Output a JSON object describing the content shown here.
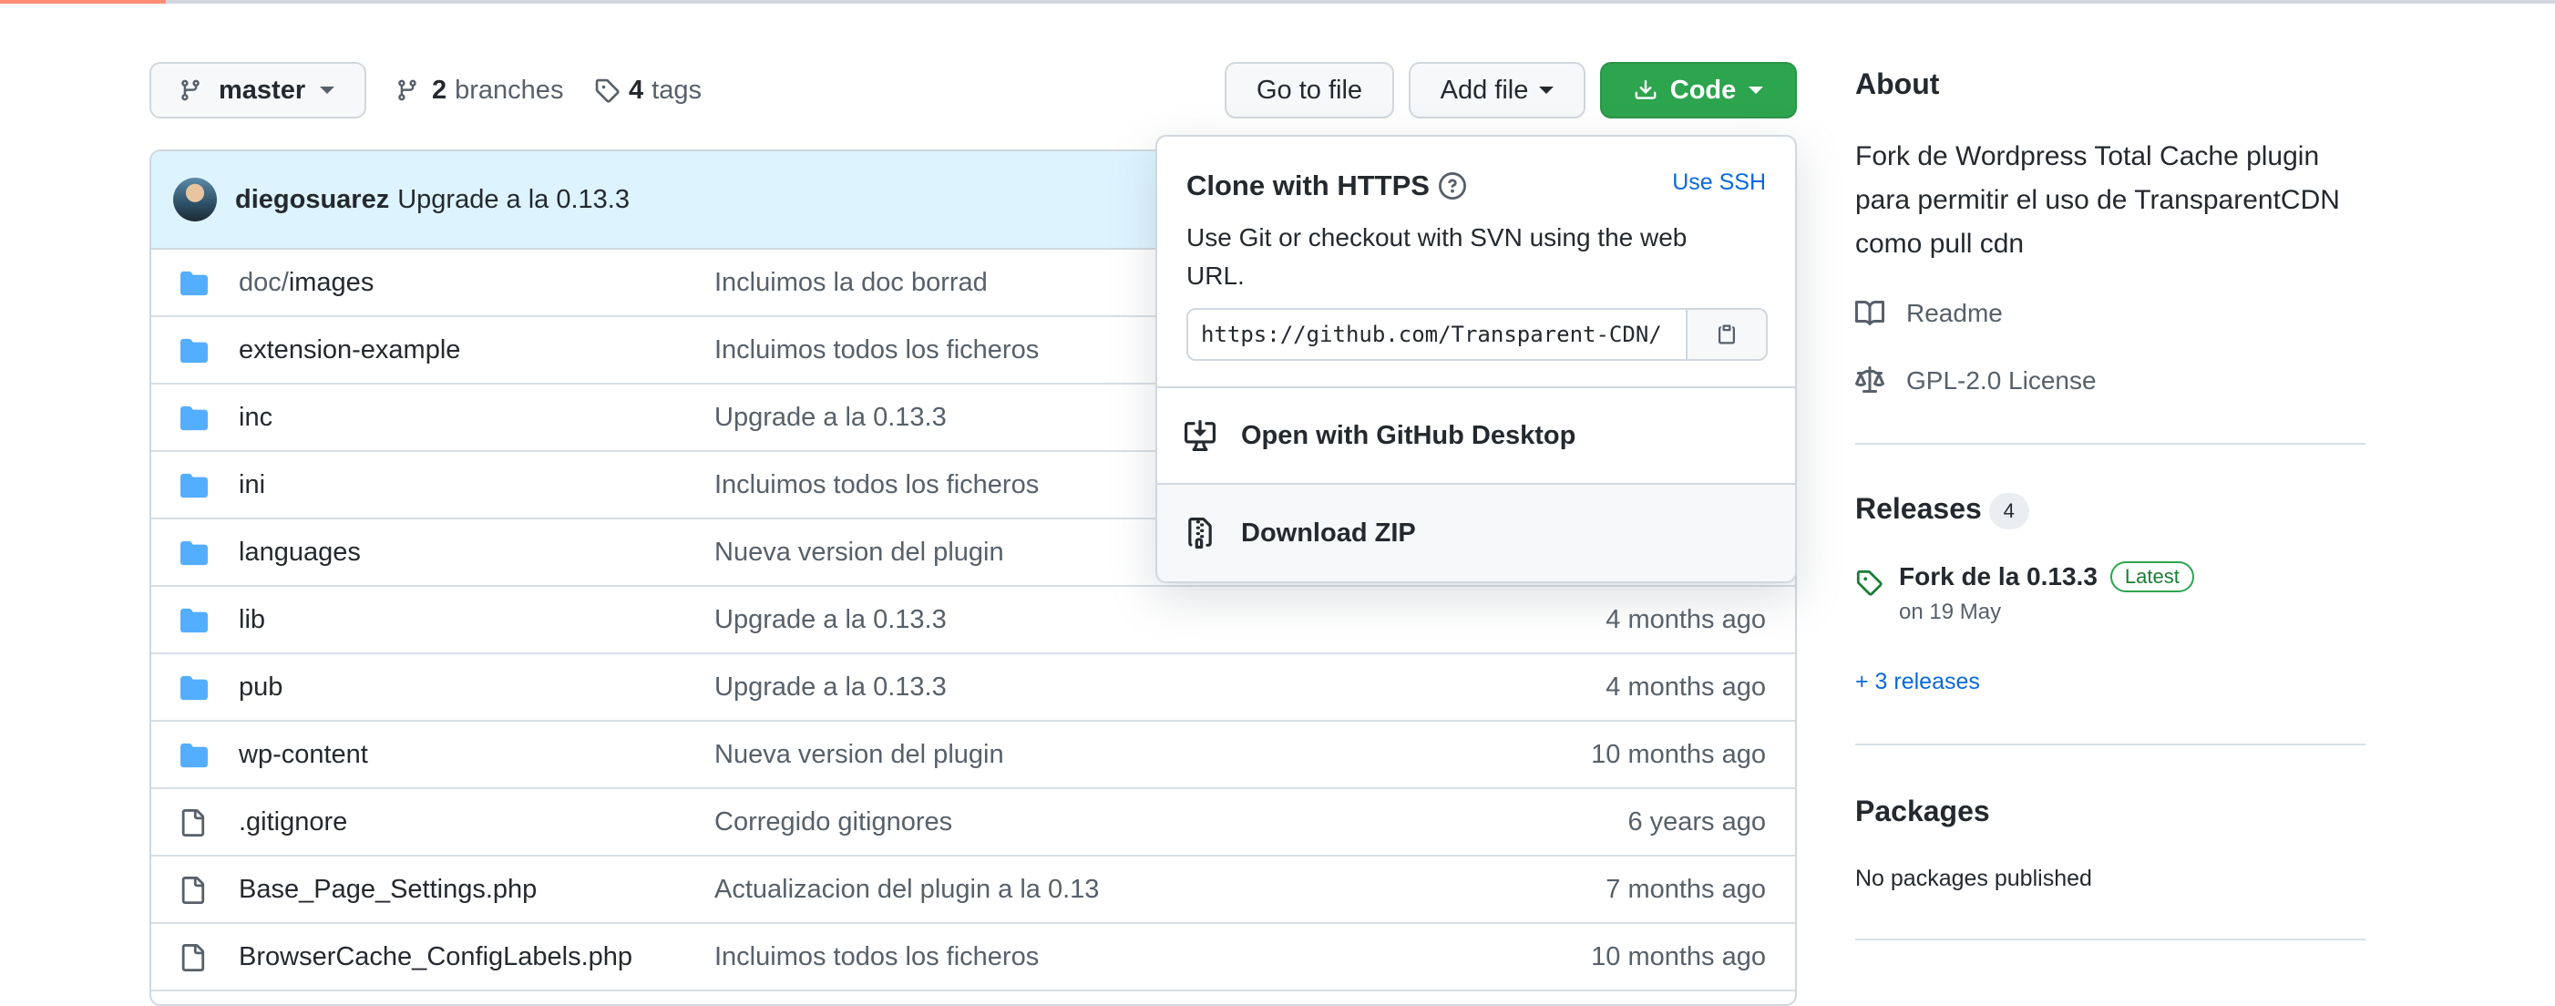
{
  "toolbar": {
    "branch_label": "master",
    "branches_count": "2",
    "branches_label": "branches",
    "tags_count": "4",
    "tags_label": "tags",
    "go_to_file_label": "Go to file",
    "add_file_label": "Add file",
    "code_label": "Code"
  },
  "commit": {
    "author": "diegosuarez",
    "message": "Upgrade a la 0.13.3"
  },
  "files": [
    {
      "type": "dir",
      "name_dim": "doc/",
      "name": "images",
      "message": "Incluimos la doc borrad",
      "age": ""
    },
    {
      "type": "dir",
      "name_dim": "",
      "name": "extension-example",
      "message": "Incluimos todos los ficheros",
      "age": ""
    },
    {
      "type": "dir",
      "name_dim": "",
      "name": "inc",
      "message": "Upgrade a la 0.13.3",
      "age": ""
    },
    {
      "type": "dir",
      "name_dim": "",
      "name": "ini",
      "message": "Incluimos todos los ficheros",
      "age": ""
    },
    {
      "type": "dir",
      "name_dim": "",
      "name": "languages",
      "message": "Nueva version del plugin",
      "age": ""
    },
    {
      "type": "dir",
      "name_dim": "",
      "name": "lib",
      "message": "Upgrade a la 0.13.3",
      "age": "4 months ago"
    },
    {
      "type": "dir",
      "name_dim": "",
      "name": "pub",
      "message": "Upgrade a la 0.13.3",
      "age": "4 months ago"
    },
    {
      "type": "dir",
      "name_dim": "",
      "name": "wp-content",
      "message": "Nueva version del plugin",
      "age": "10 months ago"
    },
    {
      "type": "file",
      "name_dim": "",
      "name": ".gitignore",
      "message": "Corregido gitignores",
      "age": "6 years ago"
    },
    {
      "type": "file",
      "name_dim": "",
      "name": "Base_Page_Settings.php",
      "message": "Actualizacion del plugin a la 0.13",
      "age": "7 months ago"
    },
    {
      "type": "file",
      "name_dim": "",
      "name": "BrowserCache_ConfigLabels.php",
      "message": "Incluimos todos los ficheros",
      "age": "10 months ago"
    }
  ],
  "clone": {
    "title": "Clone with HTTPS",
    "use_ssh": "Use SSH",
    "description": "Use Git or checkout with SVN using the web URL.",
    "url": "https://github.com/Transparent-CDN/",
    "open_desktop": "Open with GitHub Desktop",
    "download_zip": "Download ZIP"
  },
  "sidebar": {
    "about_heading": "About",
    "description": "Fork de Wordpress Total Cache plugin para permitir el uso de TransparentCDN como pull cdn",
    "readme": "Readme",
    "license": "GPL-2.0 License",
    "releases_heading": "Releases",
    "releases_count": "4",
    "release_title": "Fork de la 0.13.3",
    "release_badge": "Latest",
    "release_date": "on 19 May",
    "more_releases": "+ 3 releases",
    "packages_heading": "Packages",
    "packages_empty": "No packages published"
  },
  "colors": {
    "accent_orange": "#fd8c73",
    "code_button_green": "#2da44e",
    "folder_blue": "#54aeff",
    "link_blue": "#0969da",
    "commit_bar_bg": "#ddf4ff"
  },
  "icons": {
    "branch": "git-branch-icon",
    "tag": "tag-icon",
    "download": "download-icon",
    "folder": "folder-icon",
    "file": "file-icon",
    "help": "question-icon",
    "clipboard": "clipboard-icon",
    "desktop": "desktop-download-icon",
    "zip": "file-zip-icon",
    "book": "book-icon",
    "law": "law-icon"
  }
}
